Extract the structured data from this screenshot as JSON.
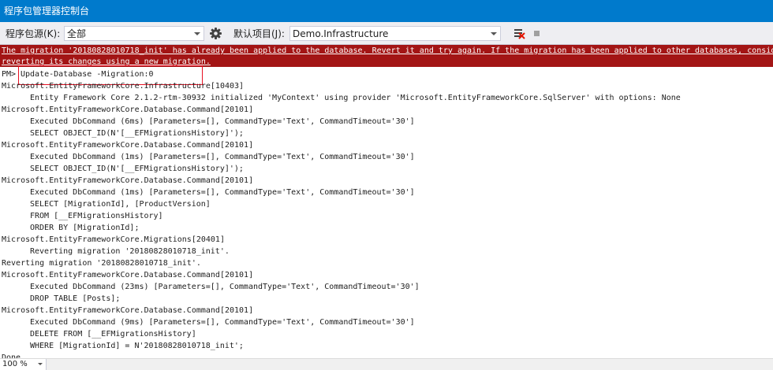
{
  "window": {
    "title": "程序包管理器控制台"
  },
  "toolbar": {
    "package_source_label": "程序包源(K):",
    "package_source_value": "全部",
    "default_project_label": "默认项目(J):",
    "default_project_value": "Demo.Infrastructure",
    "icons": [
      "gear-icon",
      "clear-console-icon",
      "stop-icon"
    ]
  },
  "console": {
    "error_lines": [
      "The migration '20180828010718_init' has already been applied to the database. Revert it and try again. If the migration has been applied to other databases, conside",
      "reverting its changes using a new migration."
    ],
    "prompt": "PM>",
    "command": "Update-Database -Migration:0",
    "lines": [
      {
        "indent": false,
        "text": "Microsoft.EntityFrameworkCore.Infrastructure[10403]"
      },
      {
        "indent": true,
        "text": "Entity Framework Core 2.1.2-rtm-30932 initialized 'MyContext' using provider 'Microsoft.EntityFrameworkCore.SqlServer' with options: None"
      },
      {
        "indent": false,
        "text": "Microsoft.EntityFrameworkCore.Database.Command[20101]"
      },
      {
        "indent": true,
        "text": "Executed DbCommand (6ms) [Parameters=[], CommandType='Text', CommandTimeout='30']"
      },
      {
        "indent": true,
        "text": "SELECT OBJECT_ID(N'[__EFMigrationsHistory]');"
      },
      {
        "indent": false,
        "text": "Microsoft.EntityFrameworkCore.Database.Command[20101]"
      },
      {
        "indent": true,
        "text": "Executed DbCommand (1ms) [Parameters=[], CommandType='Text', CommandTimeout='30']"
      },
      {
        "indent": true,
        "text": "SELECT OBJECT_ID(N'[__EFMigrationsHistory]');"
      },
      {
        "indent": false,
        "text": "Microsoft.EntityFrameworkCore.Database.Command[20101]"
      },
      {
        "indent": true,
        "text": "Executed DbCommand (1ms) [Parameters=[], CommandType='Text', CommandTimeout='30']"
      },
      {
        "indent": true,
        "text": "SELECT [MigrationId], [ProductVersion]"
      },
      {
        "indent": true,
        "text": "FROM [__EFMigrationsHistory]"
      },
      {
        "indent": true,
        "text": "ORDER BY [MigrationId];"
      },
      {
        "indent": false,
        "text": "Microsoft.EntityFrameworkCore.Migrations[20401]"
      },
      {
        "indent": true,
        "text": "Reverting migration '20180828010718_init'."
      },
      {
        "indent": false,
        "text": "Reverting migration '20180828010718_init'."
      },
      {
        "indent": false,
        "text": "Microsoft.EntityFrameworkCore.Database.Command[20101]"
      },
      {
        "indent": true,
        "text": "Executed DbCommand (23ms) [Parameters=[], CommandType='Text', CommandTimeout='30']"
      },
      {
        "indent": true,
        "text": "DROP TABLE [Posts];"
      },
      {
        "indent": false,
        "text": "Microsoft.EntityFrameworkCore.Database.Command[20101]"
      },
      {
        "indent": true,
        "text": "Executed DbCommand (9ms) [Parameters=[], CommandType='Text', CommandTimeout='30']"
      },
      {
        "indent": true,
        "text": "DELETE FROM [__EFMigrationsHistory]"
      },
      {
        "indent": true,
        "text": "WHERE [MigrationId] = N'20180828010718_init';"
      },
      {
        "indent": false,
        "text": "Done."
      }
    ]
  },
  "statusbar": {
    "zoom": "100 %"
  },
  "colors": {
    "title_bar": "#007acc",
    "error_bg": "#a31515",
    "highlight_border": "#e81123",
    "toolbar_bg": "#eeeef2"
  }
}
